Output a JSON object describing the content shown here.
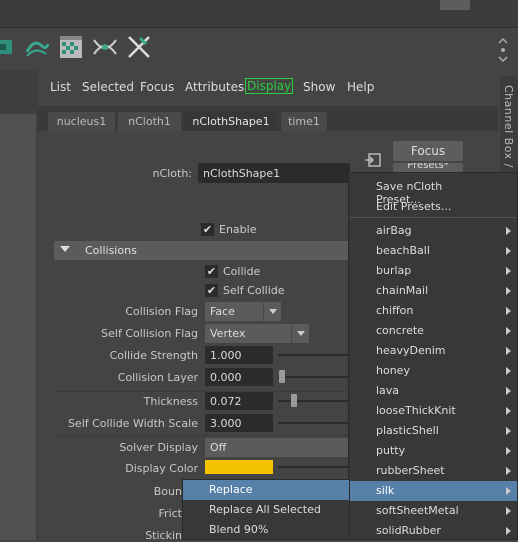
{
  "menubar": {
    "items": [
      "List",
      "Selected",
      "Focus",
      "Attributes",
      "Display",
      "Show",
      "Help"
    ]
  },
  "side_tab": "Channel Box / La",
  "tabs": [
    "nucleus1",
    "nCloth1",
    "nClothShape1",
    "time1"
  ],
  "header": {
    "ncloth_label": "nCloth:",
    "ncloth_value": "nClothShape1",
    "focus_button": "Focus",
    "presets_button": "Presets*",
    "enable": "Enable"
  },
  "section": "Collisions",
  "checks": {
    "collide": "Collide",
    "self_collide": "Self Collide"
  },
  "attrs": {
    "collision_flag": {
      "label": "Collision Flag",
      "value": "Face"
    },
    "self_collision_flag": {
      "label": "Self Collision Flag",
      "value": "Vertex"
    },
    "collide_strength": {
      "label": "Collide Strength",
      "value": "1.000"
    },
    "collision_layer": {
      "label": "Collision Layer",
      "value": "0.000"
    },
    "thickness": {
      "label": "Thickness",
      "value": "0.072"
    },
    "self_collide_width_scale": {
      "label": "Self Collide Width Scale",
      "value": "3.000"
    },
    "solver_display": {
      "label": "Solver Display",
      "value": "Off"
    },
    "display_color": {
      "label": "Display Color",
      "value": "#f5c400"
    },
    "bounce": {
      "label": "Boun"
    },
    "friction": {
      "label": "Frict"
    },
    "stickiness": {
      "label": "Stickin"
    }
  },
  "presets_menu": {
    "top": [
      "Save nCloth Preset...",
      "Edit Presets..."
    ],
    "presets": [
      "airBag",
      "beachBall",
      "burlap",
      "chainMail",
      "chiffon",
      "concrete",
      "heavyDenim",
      "honey",
      "lava",
      "looseThickKnit",
      "plasticShell",
      "putty",
      "rubberSheet",
      "silk",
      "softSheetMetal",
      "solidRubber"
    ],
    "selected": "silk"
  },
  "submenu": [
    "Replace",
    "Replace All Selected",
    "Blend 90%"
  ],
  "colors": {
    "accent_green": "#2ecc40",
    "highlight": "#5680a8",
    "display_color": "#f5c400"
  }
}
